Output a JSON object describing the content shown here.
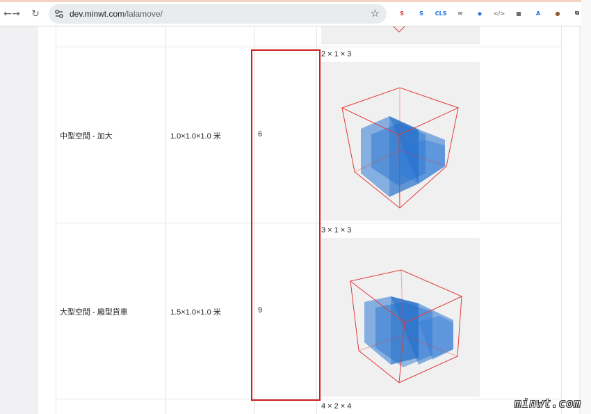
{
  "browser": {
    "url_host": "dev.minwt.com",
    "url_path": "/lalamove/",
    "extensions": [
      {
        "name": "s-extension-icon",
        "text": "S",
        "color": "#d32f2f"
      },
      {
        "name": "s-box-extension-icon",
        "text": "S",
        "color": "#1a73e8"
      },
      {
        "name": "cls-extension-icon",
        "text": "CLS",
        "color": "#1a73e8"
      },
      {
        "name": "mail-icon",
        "text": "✉",
        "color": "#444444"
      },
      {
        "name": "tag-icon",
        "text": "◆",
        "color": "#1a73e8"
      },
      {
        "name": "code-icon",
        "text": "</>",
        "color": "#777777"
      },
      {
        "name": "grid-icon",
        "text": "▦",
        "color": "#333333"
      },
      {
        "name": "translate-icon",
        "text": "A",
        "color": "#1a73e8"
      },
      {
        "name": "cookie-icon",
        "text": "●",
        "color": "#8d5a2b"
      },
      {
        "name": "puzzle-icon",
        "text": "⧉",
        "color": "#333333"
      }
    ]
  },
  "table": {
    "rows": [
      {
        "name": "中型空間 - 加大",
        "size": "1.0×1.0×1.0 米",
        "count": "6",
        "dims": "2 × 1 × 3"
      },
      {
        "name": "大型空間 - 廂型貨車",
        "size": "1.5×1.0×1.0 米",
        "count": "9",
        "dims": "3 × 1 × 3"
      }
    ],
    "next_dims": "4 × 2 × 4"
  },
  "watermark": "minwt.com"
}
